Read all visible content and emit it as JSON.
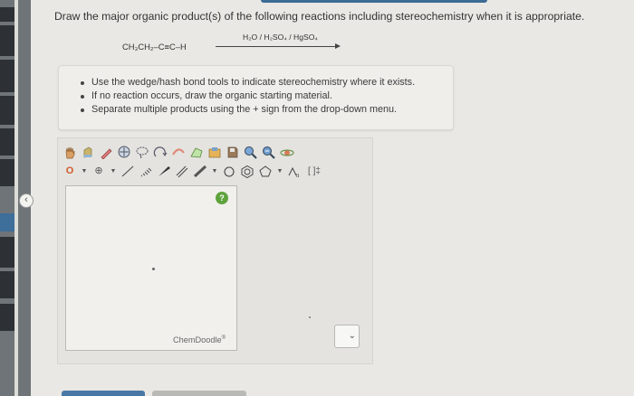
{
  "question": {
    "prompt": "Draw the major organic product(s) of the following reactions including stereochemistry when it is appropriate."
  },
  "reaction": {
    "reactant": "CH₃CH₂–C≡C–H",
    "reagents": "H₂O / H₂SO₄ / HgSO₄"
  },
  "instructions": {
    "items": [
      "Use the wedge/hash bond tools to indicate stereochemistry where it exists.",
      "If no reaction occurs, draw the organic starting material.",
      "Separate multiple products using the + sign from the drop-down menu."
    ]
  },
  "sketcher": {
    "brand": "ChemDoodle",
    "brand_mark": "®",
    "help_label": "?",
    "element_button": "O",
    "plus_tool": "⊕",
    "charge_tool": "[ ]‡",
    "toolbar_row1_icons": [
      "hand-icon",
      "eraser-icon",
      "pencil-icon",
      "ring-template-icon",
      "lasso-icon",
      "rotate-icon",
      "clean-icon",
      "template-icon",
      "open-file-icon",
      "zoom-in-icon",
      "zoom-out-icon",
      "atom-icon"
    ],
    "toolbar_row2_icons": [
      "element-picker",
      "charge-picker",
      "single-bond-icon",
      "hash-bond-icon",
      "wedge-bond-icon",
      "double-bond-icon",
      "bold-bond-icon",
      "benzene-icon",
      "cyclohexane-icon",
      "pentagon-icon",
      "chain-icon",
      "bracket-icon"
    ]
  },
  "colors": {
    "help": "#5fa33d",
    "accent": "#4a78a5",
    "sidebar": "#2d3135"
  }
}
